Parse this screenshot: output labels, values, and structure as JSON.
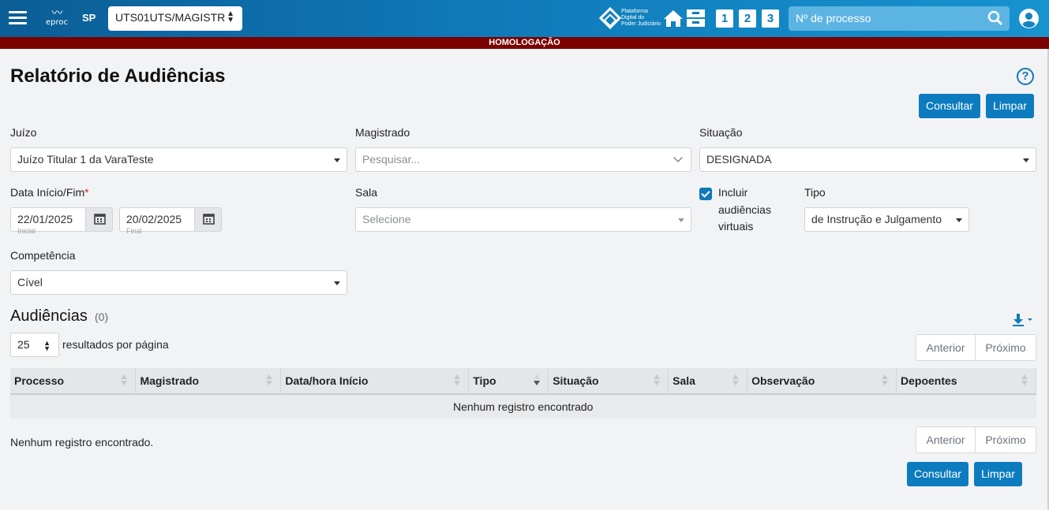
{
  "header": {
    "logo_text": "eproc",
    "state": "SP",
    "unit_select": "UTS01UTS/MAGISTR",
    "pdpj_text": [
      "Plataforma",
      "Digital do",
      "Poder Judiciário"
    ],
    "shortcuts": [
      "1",
      "2",
      "3"
    ],
    "search_placeholder": "Nº de processo",
    "icons": [
      "menu-icon",
      "home-icon",
      "inbox-icon",
      "search-icon",
      "user-icon"
    ]
  },
  "env_banner": "HOMOLOGAÇÃO",
  "page": {
    "title": "Relatório de Audiências",
    "help": "?",
    "consultar": "Consultar",
    "limpar": "Limpar"
  },
  "filters": {
    "juizo_label": "Juízo",
    "juizo_value": "Juízo Titular 1 da VaraTeste",
    "magistrado_label": "Magistrado",
    "magistrado_placeholder": "Pesquisar...",
    "situacao_label": "Situação",
    "situacao_value": "DESIGNADA",
    "data_label": "Data Início/Fim",
    "data_required": "*",
    "data_inicio": "22/01/2025",
    "data_inicio_sub": "Inicial",
    "data_fim": "20/02/2025",
    "data_fim_sub": "Final",
    "sala_label": "Sala",
    "sala_placeholder": "Selecione",
    "incluir_virtuais": "Incluir audiências virtuais",
    "incluir_virtuais_checked": true,
    "tipo_label": "Tipo",
    "tipo_value": "de Instrução e Julgamento",
    "competencia_label": "Competência",
    "competencia_value": "Cível"
  },
  "results": {
    "title": "Audiências",
    "count": "(0)",
    "per_page": "25",
    "per_page_label": "resultados por página",
    "pager_prev": "Anterior",
    "pager_next": "Próximo",
    "columns": [
      "Processo",
      "Magistrado",
      "Data/hora Início",
      "Tipo",
      "Situação",
      "Sala",
      "Observação",
      "Depoentes"
    ],
    "empty_row": "Nenhum registro encontrado",
    "footer_text": "Nenhum registro encontrado."
  },
  "colors": {
    "topbar": "#0f79b8",
    "banner": "#7b0000",
    "primary_button": "#0d7cbf",
    "background": "#f2f3f5"
  }
}
